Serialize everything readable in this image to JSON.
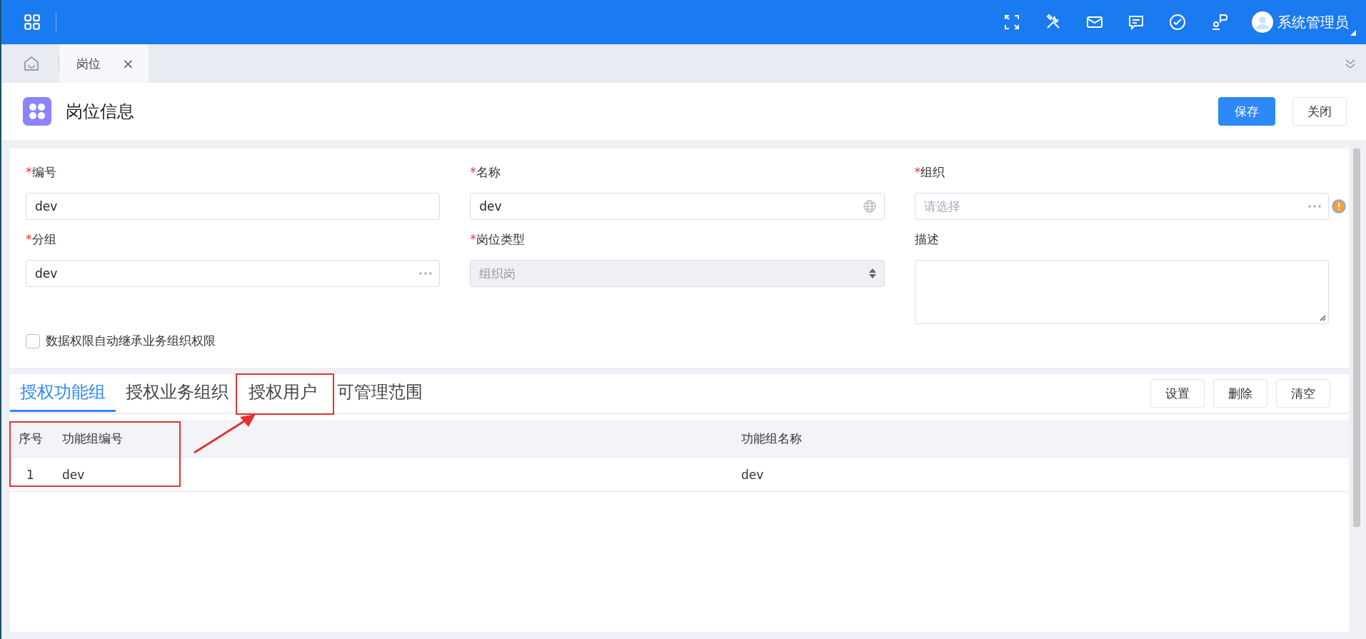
{
  "top_bar": {
    "user": "系统管理员"
  },
  "page_tabs": [
    {
      "label": "岗位",
      "selected": true,
      "close": "×"
    }
  ],
  "header": {
    "title": "岗位信息",
    "buttons": [
      {
        "label": "保存",
        "kind": "primary"
      },
      {
        "label": "关闭",
        "kind": "default"
      }
    ]
  },
  "form": {
    "fields": [
      {
        "label": "编号",
        "required_mark": "*",
        "kind": "text",
        "value": "dev"
      },
      {
        "label": "名称",
        "required_mark": "*",
        "kind": "globe",
        "value": "dev"
      },
      {
        "label": "组织",
        "required_mark": "*",
        "kind": "picker",
        "placeholder": "请选择",
        "warning": true
      },
      {
        "label": "分组",
        "required_mark": "*",
        "kind": "picker",
        "value": "dev"
      },
      {
        "label": "岗位类型",
        "required_mark": "*",
        "kind": "select",
        "value": "组织岗",
        "disabled": true
      },
      {
        "label": "描述",
        "kind": "textarea"
      }
    ],
    "checkbox": {
      "label": "数据权限自动继承业务组织权限",
      "checked": false
    }
  },
  "detail_tabs": [
    {
      "label": "授权功能组",
      "selected": true
    },
    {
      "label": "授权业务组织",
      "selected": false
    },
    {
      "label": "授权用户",
      "selected": false
    },
    {
      "label": "可管理范围",
      "selected": false
    }
  ],
  "actions": [
    "设置",
    "删除",
    "清空"
  ],
  "table": {
    "columns": [
      "序号",
      "功能组编号",
      "功能组名称"
    ],
    "rows": [
      [
        "1",
        "dev",
        "dev"
      ]
    ]
  }
}
